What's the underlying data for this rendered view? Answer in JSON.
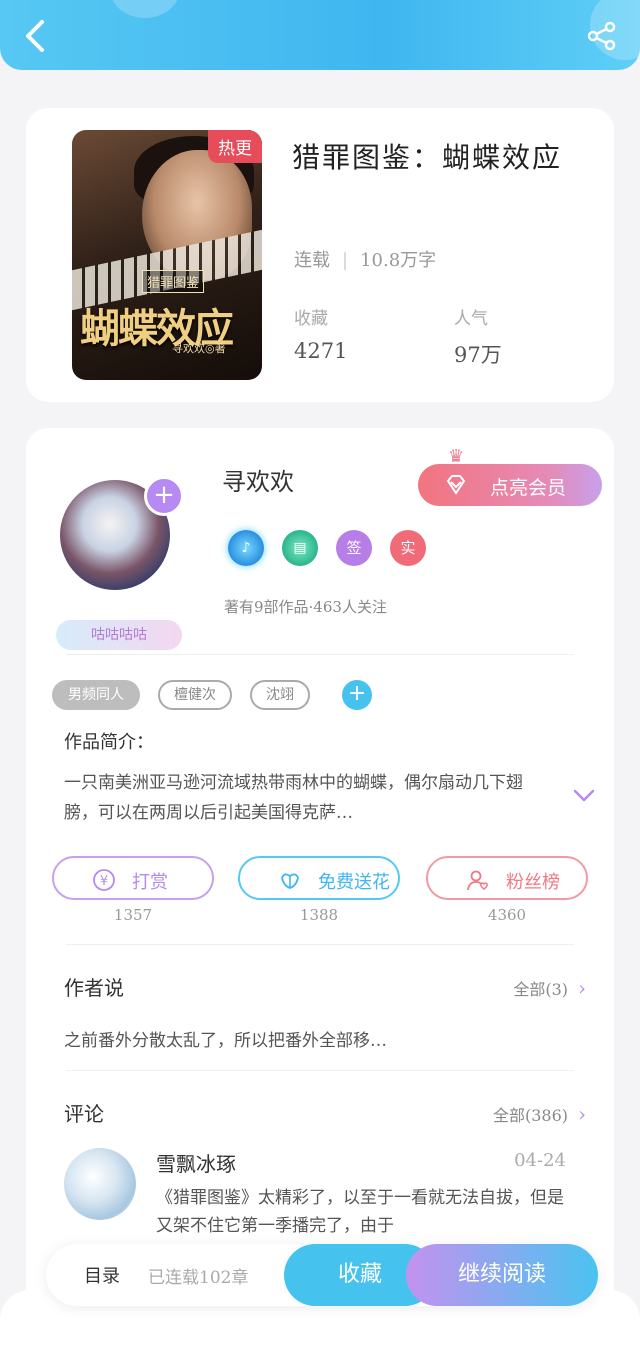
{
  "header": {
    "back_icon": "chevron-left-icon",
    "share_icon": "share-icon"
  },
  "book": {
    "title": "猎罪图鉴：蝴蝶效应",
    "status": "连载",
    "word_count": "10.8万字",
    "cover": {
      "badge": "热更",
      "series": "猎罪图鉴",
      "title": "蝴蝶效应",
      "author": "寻欢欢◎著"
    },
    "stats": [
      {
        "label": "收藏",
        "value": "4271"
      },
      {
        "label": "人气",
        "value": "97万"
      }
    ]
  },
  "author": {
    "name": "寻欢欢",
    "vip_label": "点亮会员",
    "sticker": "咕咕咕咕",
    "badges": [
      "music-badge-icon",
      "book-badge-icon",
      "签",
      "实"
    ],
    "info": "著有9部作品·463人关注"
  },
  "tags": [
    "男频同人",
    "檀健次",
    "沈翊"
  ],
  "intro": {
    "label": "作品简介：",
    "text": "一只南美洲亚马逊河流域热带雨林中的蝴蝶，偶尔扇动几下翅膀，可以在两周以后引起美国得克萨…"
  },
  "actions": [
    {
      "label": "打赏",
      "count": "1357",
      "icon": "yen-icon"
    },
    {
      "label": "免费送花",
      "count": "1388",
      "icon": "flower-icon"
    },
    {
      "label": "粉丝榜",
      "count": "4360",
      "icon": "user-heart-icon"
    }
  ],
  "author_says": {
    "title": "作者说",
    "all": "全部(3)",
    "text": "之前番外分散太乱了，所以把番外全部移…"
  },
  "comments": {
    "title": "评论",
    "all": "全部(386)",
    "items": [
      {
        "name": "雪飘冰琢",
        "date": "04-24",
        "text": "《猎罪图鉴》太精彩了，以至于一看就无法自拔，但是又架不住它第一季播完了，由于"
      }
    ]
  },
  "bottom": {
    "toc": "目录",
    "serial": "已连载102章",
    "favorite": "收藏",
    "continue": "继续阅读"
  },
  "colors": {
    "header": "#3fb6f0",
    "purple": "#b68af2",
    "pink": "#ef7a86",
    "blue": "#45c2ee"
  }
}
